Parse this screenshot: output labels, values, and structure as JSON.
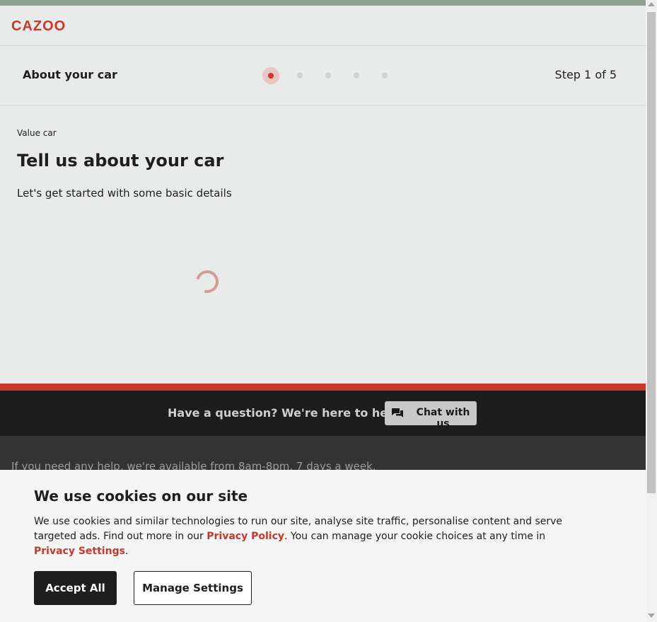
{
  "header": {
    "logo_text": "CAZOO"
  },
  "stepper": {
    "title": "About your car",
    "step_text": "Step 1 of 5",
    "current_step": 1,
    "total_steps": 5
  },
  "main": {
    "eyebrow": "Value car",
    "heading": "Tell us about your car",
    "subtext": "Let's get started with some basic details",
    "loading_icon": "spinner-icon"
  },
  "help_bar": {
    "text": "Have a question? We're here to help.",
    "chat_button_label": "Chat with us",
    "chat_icon": "chat-bubbles-icon"
  },
  "footer": {
    "availability_text": "If you need any help, we're available from 8am-8pm, 7 days a week."
  },
  "cookie_banner": {
    "title": "We use cookies on our site",
    "body_part1": "We use cookies and similar technologies to run our site, analyse site traffic, personalise content and serve targeted ads. Find out more in our ",
    "privacy_policy_link": "Privacy Policy",
    "body_part2": ". You can manage your cookie choices at any time in ",
    "privacy_settings_link": "Privacy Settings",
    "body_part3": ".",
    "accept_label": "Accept All",
    "manage_label": "Manage Settings"
  },
  "colors": {
    "brand_red": "#c8382c",
    "dark": "#1e1e1e",
    "header_stripe": "#8fa291"
  }
}
